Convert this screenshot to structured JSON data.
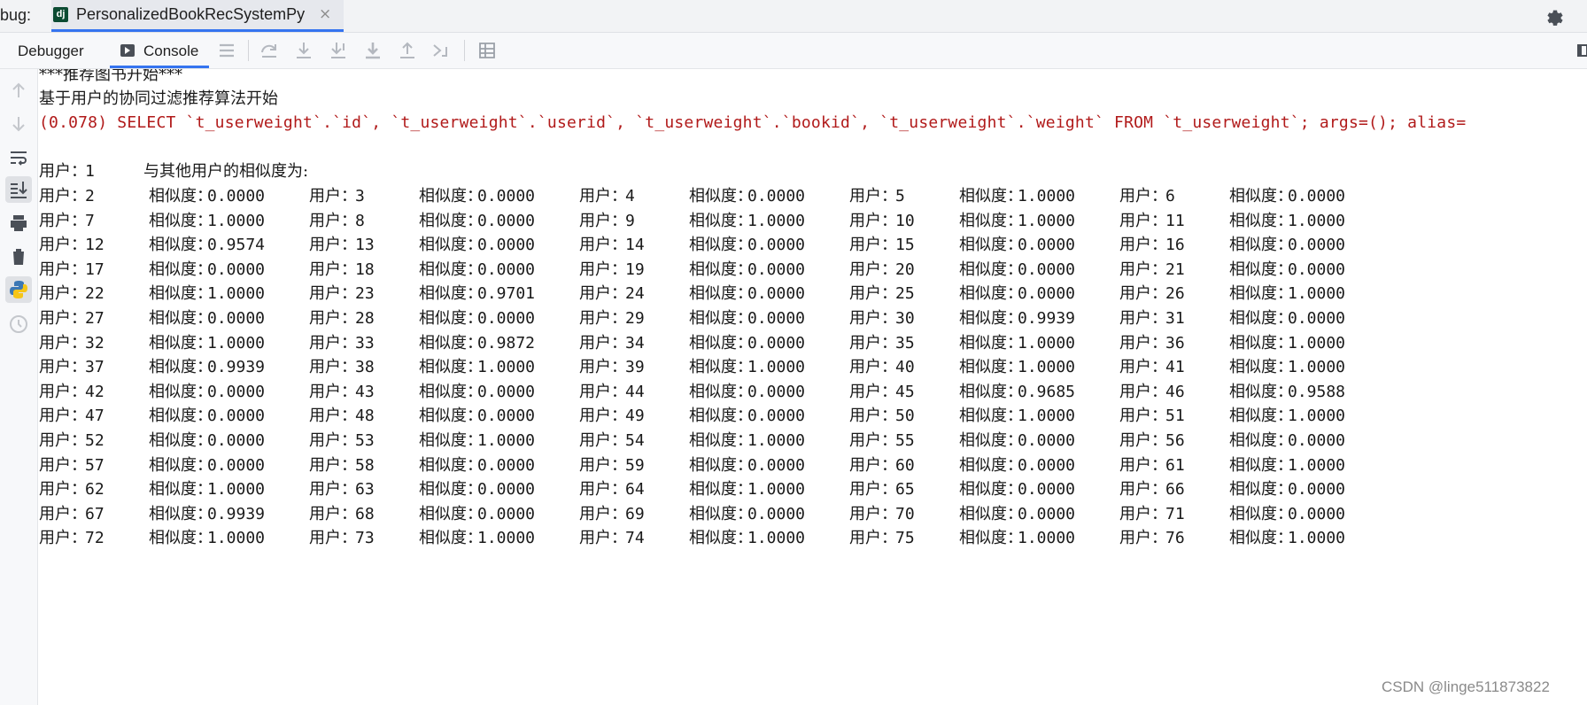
{
  "tabbar": {
    "prefix": "bug:",
    "tab_icon_text": "dj",
    "tab_title": "PersonalizedBookRecSystemPy",
    "close_glyph": "×"
  },
  "toolbar": {
    "debugger_label": "Debugger",
    "console_label": "Console",
    "icons": [
      "menu-icon",
      "step-over-icon",
      "step-into-icon",
      "step-into-my-code-icon",
      "force-step-into-icon",
      "step-out-icon",
      "run-to-cursor-icon",
      "evaluate-table-icon"
    ]
  },
  "gutter": {
    "icons": [
      "up-arrow-icon",
      "down-arrow-icon",
      "soft-wrap-icon",
      "scroll-to-end-icon",
      "print-icon",
      "trash-icon",
      "python-console-icon",
      "history-icon"
    ]
  },
  "console": {
    "line1": "***推荐图书开始***",
    "line2": "基于用户的协同过滤推荐算法开始",
    "sql": "(0.078) SELECT `t_userweight`.`id`, `t_userweight`.`userid`, `t_userweight`.`bookid`, `t_userweight`.`weight` FROM `t_userweight`; args=(); alias=",
    "user_label": "用户：",
    "sim_label": "相似度：",
    "header_user": "1",
    "header_text": "与其他用户的相似度为:",
    "rows": [
      [
        [
          "2",
          "0.0000"
        ],
        [
          "3",
          "0.0000"
        ],
        [
          "4",
          "0.0000"
        ],
        [
          "5",
          "1.0000"
        ],
        [
          "6",
          "0.0000"
        ]
      ],
      [
        [
          "7",
          "1.0000"
        ],
        [
          "8",
          "0.0000"
        ],
        [
          "9",
          "1.0000"
        ],
        [
          "10",
          "1.0000"
        ],
        [
          "11",
          "1.0000"
        ]
      ],
      [
        [
          "12",
          "0.9574"
        ],
        [
          "13",
          "0.0000"
        ],
        [
          "14",
          "0.0000"
        ],
        [
          "15",
          "0.0000"
        ],
        [
          "16",
          "0.0000"
        ]
      ],
      [
        [
          "17",
          "0.0000"
        ],
        [
          "18",
          "0.0000"
        ],
        [
          "19",
          "0.0000"
        ],
        [
          "20",
          "0.0000"
        ],
        [
          "21",
          "0.0000"
        ]
      ],
      [
        [
          "22",
          "1.0000"
        ],
        [
          "23",
          "0.9701"
        ],
        [
          "24",
          "0.0000"
        ],
        [
          "25",
          "0.0000"
        ],
        [
          "26",
          "1.0000"
        ]
      ],
      [
        [
          "27",
          "0.0000"
        ],
        [
          "28",
          "0.0000"
        ],
        [
          "29",
          "0.0000"
        ],
        [
          "30",
          "0.9939"
        ],
        [
          "31",
          "0.0000"
        ]
      ],
      [
        [
          "32",
          "1.0000"
        ],
        [
          "33",
          "0.9872"
        ],
        [
          "34",
          "0.0000"
        ],
        [
          "35",
          "1.0000"
        ],
        [
          "36",
          "1.0000"
        ]
      ],
      [
        [
          "37",
          "0.9939"
        ],
        [
          "38",
          "1.0000"
        ],
        [
          "39",
          "1.0000"
        ],
        [
          "40",
          "1.0000"
        ],
        [
          "41",
          "1.0000"
        ]
      ],
      [
        [
          "42",
          "0.0000"
        ],
        [
          "43",
          "0.0000"
        ],
        [
          "44",
          "0.0000"
        ],
        [
          "45",
          "0.9685"
        ],
        [
          "46",
          "0.9588"
        ]
      ],
      [
        [
          "47",
          "0.0000"
        ],
        [
          "48",
          "0.0000"
        ],
        [
          "49",
          "0.0000"
        ],
        [
          "50",
          "1.0000"
        ],
        [
          "51",
          "1.0000"
        ]
      ],
      [
        [
          "52",
          "0.0000"
        ],
        [
          "53",
          "1.0000"
        ],
        [
          "54",
          "1.0000"
        ],
        [
          "55",
          "0.0000"
        ],
        [
          "56",
          "0.0000"
        ]
      ],
      [
        [
          "57",
          "0.0000"
        ],
        [
          "58",
          "0.0000"
        ],
        [
          "59",
          "0.0000"
        ],
        [
          "60",
          "0.0000"
        ],
        [
          "61",
          "1.0000"
        ]
      ],
      [
        [
          "62",
          "1.0000"
        ],
        [
          "63",
          "0.0000"
        ],
        [
          "64",
          "1.0000"
        ],
        [
          "65",
          "0.0000"
        ],
        [
          "66",
          "0.0000"
        ]
      ],
      [
        [
          "67",
          "0.9939"
        ],
        [
          "68",
          "0.0000"
        ],
        [
          "69",
          "0.0000"
        ],
        [
          "70",
          "0.0000"
        ],
        [
          "71",
          "0.0000"
        ]
      ],
      [
        [
          "72",
          "1.0000"
        ],
        [
          "73",
          "1.0000"
        ],
        [
          "74",
          "1.0000"
        ],
        [
          "75",
          "1.0000"
        ],
        [
          "76",
          "1.0000"
        ]
      ]
    ]
  },
  "watermark": "CSDN @linge511873822",
  "colors": {
    "accent": "#3574f0",
    "sql_text": "#b11a1a",
    "django_icon": "#0c4b33"
  }
}
